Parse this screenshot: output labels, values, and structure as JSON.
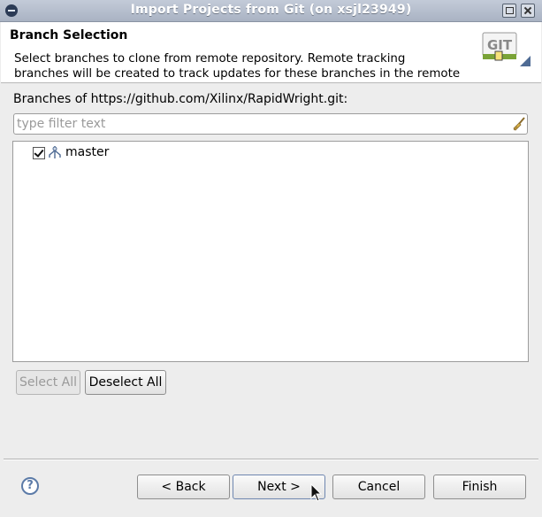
{
  "window": {
    "title": "Import Projects from Git  (on xsjl23949)"
  },
  "header": {
    "title": "Branch Selection",
    "description": "Select branches to clone from remote repository. Remote tracking\nbranches will be created to track updates for these branches in the remote",
    "badge_text": "GIT"
  },
  "branches": {
    "label": "Branches of https://github.com/Xilinx/RapidWright.git:",
    "filter_placeholder": "type filter text",
    "filter_value": "",
    "items": [
      {
        "name": "master",
        "checked": true
      }
    ]
  },
  "selection_buttons": {
    "select_all": "Select All",
    "deselect_all": "Deselect All"
  },
  "footer": {
    "back": "< Back",
    "next": "Next >",
    "cancel": "Cancel",
    "finish": "Finish",
    "help_symbol": "?"
  },
  "colors": {
    "title_bar": "#b4bccb",
    "help": "#5c7ba8",
    "git_badge_green": "#7aa337"
  }
}
